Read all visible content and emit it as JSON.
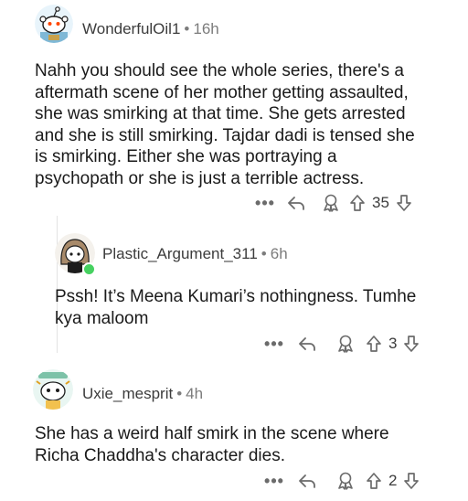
{
  "comments": [
    {
      "username": "WonderfulOil1",
      "separator": "•",
      "age": "16h",
      "lines": [
        "Nahh you should see the whole series, there's a",
        "aftermath scene of her mother getting assaulted,",
        "she was smirking at that time. She gets arrested",
        "and she is still smirking. Tajdar dadi is tensed she",
        "is smirking. Either she was portraying a",
        "psychopath or she is just a terrible actress."
      ],
      "more": "•••",
      "score": "35"
    },
    {
      "username": "Plastic_Argument_311",
      "separator": "•",
      "age": "6h",
      "lines": [
        "Pssh! It’s Meena Kumari’s nothingness. Tumhe",
        "kya maloom"
      ],
      "more": "•••",
      "score": "3",
      "online_color": "#46d160"
    },
    {
      "username": "Uxie_mesprit",
      "separator": "•",
      "age": "4h",
      "lines": [
        "She has a weird half smirk in the scene where",
        "Richa Chaddha's character dies."
      ],
      "more": "•••",
      "score": "2"
    }
  ],
  "icons": {
    "more": "more-icon",
    "reply": "reply-icon",
    "award": "award-icon",
    "upvote": "upvote-icon",
    "downvote": "downvote-icon"
  }
}
